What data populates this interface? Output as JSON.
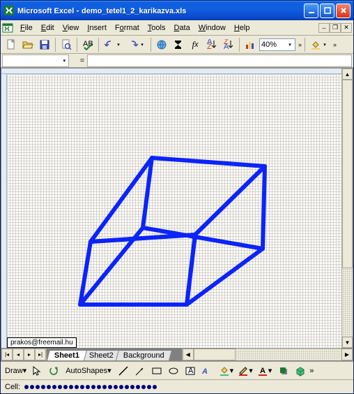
{
  "titlebar": {
    "app": "Microsoft Excel",
    "doc": "demo_tetel1_2_karikazva.xls"
  },
  "menus": [
    {
      "label": "File",
      "accel": 0
    },
    {
      "label": "Edit",
      "accel": 0
    },
    {
      "label": "View",
      "accel": 0
    },
    {
      "label": "Insert",
      "accel": 0
    },
    {
      "label": "Format",
      "accel": 1
    },
    {
      "label": "Tools",
      "accel": 0
    },
    {
      "label": "Data",
      "accel": 0
    },
    {
      "label": "Window",
      "accel": 0
    },
    {
      "label": "Help",
      "accel": 0
    }
  ],
  "toolbar": {
    "zoom": "40%"
  },
  "namebox": "",
  "formula": "",
  "statusbar": {
    "label": "Cell:"
  },
  "drawing": {
    "draw": "Draw",
    "autoshapes": "AutoShapes"
  },
  "sheet": {
    "email": "prakos@freemail.hu",
    "tabs": [
      {
        "label": "Sheet1",
        "active": true
      },
      {
        "label": "Sheet2",
        "active": false
      },
      {
        "label": "Background",
        "active": false
      }
    ]
  },
  "colors": {
    "accent": "#0b24fb",
    "chrome": "#ece9d8",
    "titlebar": "#0f5fe0"
  }
}
